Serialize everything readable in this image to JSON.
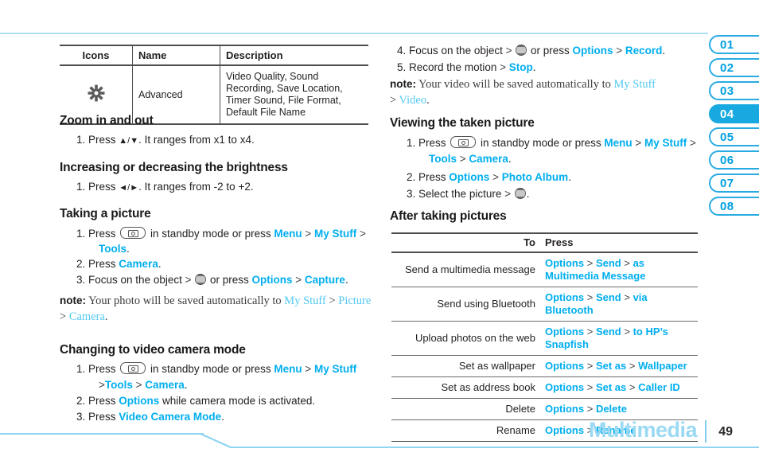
{
  "footer": {
    "section_title": "Multimedia",
    "page_number": "49"
  },
  "side_tabs": [
    {
      "label": "01",
      "active": false
    },
    {
      "label": "02",
      "active": false
    },
    {
      "label": "03",
      "active": false
    },
    {
      "label": "04",
      "active": true
    },
    {
      "label": "05",
      "active": false
    },
    {
      "label": "06",
      "active": false
    },
    {
      "label": "07",
      "active": false
    },
    {
      "label": "08",
      "active": false
    }
  ],
  "left_column": {
    "icon_table": {
      "headers": {
        "icons": "Icons",
        "name": "Name",
        "description": "Description"
      },
      "rows": [
        {
          "icon": "gear-icon",
          "name": "Advanced",
          "description": "Video Quality, Sound Recording, Save Location, Timer Sound, File Format, Default File Name"
        }
      ]
    },
    "sections": [
      {
        "heading": "Zoom in and out",
        "steps": [
          {
            "num": "1.",
            "text_a": "Press ",
            "arrows": "▲/▼",
            "text_b": ". It ranges from x1 to x4."
          }
        ]
      },
      {
        "heading": "Increasing or decreasing the brightness",
        "steps": [
          {
            "num": "1.",
            "text_a": "Press ",
            "arrows": "◄/►",
            "text_b": ". It ranges from -2 to +2."
          }
        ]
      },
      {
        "heading": "Taking a picture",
        "step1": {
          "num": "1.",
          "pre": "Press ",
          "key": "camera-key-icon",
          "mid": " in standby mode or press ",
          "menu": "Menu",
          "gt1": " > ",
          "mystuff": "My Stuff",
          "gt2": " > ",
          "tools": "Tools",
          "end": "."
        },
        "step2": {
          "num": "2.",
          "pre": "Press ",
          "camera": "Camera",
          "end": "."
        },
        "step3": {
          "num": "3.",
          "pre": "Focus on the object ",
          "gt1": "> ",
          "icon": "att-globe-icon",
          "mid": " or press ",
          "options": "Options",
          "gt2": " > ",
          "capture": "Capture",
          "end": "."
        },
        "note": {
          "label": "note:",
          "t1": " Your photo will be saved automatically to ",
          "l1": "My Stuff",
          "gt1": " > ",
          "l2": "Picture",
          "gt2": " > ",
          "l3": "Camera",
          "end": "."
        }
      },
      {
        "heading": "Changing to video camera mode",
        "step1": {
          "num": "1.",
          "pre": "Press ",
          "key": "camera-key-icon",
          "mid": " in standby mode or press ",
          "menu": "Menu",
          "gt1": " > ",
          "mystuff": "My Stuff",
          "gt2": ">",
          "tools": "Tools",
          "gt3": " > ",
          "camera": "Camera",
          "end": "."
        },
        "step2": {
          "num": "2.",
          "pre": "Press ",
          "options": "Options",
          "post": " while camera mode is activated."
        },
        "step3": {
          "num": "3.",
          "pre": "Press ",
          "mode": "Video Camera Mode",
          "end": "."
        }
      }
    ]
  },
  "right_column": {
    "continued_steps": {
      "step4": {
        "num": "4.",
        "pre": "Focus on the object ",
        "gt1": "> ",
        "icon": "att-globe-icon",
        "mid": " or press ",
        "options": "Options",
        "gt2": " > ",
        "record": "Record",
        "end": "."
      },
      "step5": {
        "num": "5.",
        "pre": "Record the motion ",
        "gt1": "> ",
        "stop": "Stop",
        "end": "."
      },
      "note": {
        "label": "note:",
        "t1": " Your video will be saved automatically to ",
        "l1": "My Stuff",
        "gt1": "> ",
        "l2": "Video",
        "end": "."
      }
    },
    "viewing_section": {
      "heading": "Viewing the taken picture",
      "step1": {
        "num": "1.",
        "pre": "Press ",
        "key": "camera-key-icon",
        "mid": " in standby mode or press ",
        "menu": "Menu",
        "gt1": " > ",
        "mystuff": "My Stuff",
        "gt2": " > ",
        "tools": "Tools",
        "gt3": " > ",
        "camera": "Camera",
        "end": "."
      },
      "step2": {
        "num": "2.",
        "pre": "Press ",
        "options": "Options",
        "gt1": " > ",
        "album": "Photo Album",
        "end": "."
      },
      "step3": {
        "num": "3.",
        "pre": "Select the picture ",
        "gt1": "> ",
        "icon": "att-globe-icon",
        "end": "."
      }
    },
    "after_section": {
      "heading": "After taking pictures",
      "table": {
        "headers": {
          "to": "To",
          "press": "Press"
        },
        "rows": [
          {
            "to": "Send a multimedia message",
            "press": [
              "Options",
              "Send",
              "as Multimedia Message"
            ]
          },
          {
            "to": "Send using Bluetooth",
            "press": [
              "Options",
              "Send",
              "via Bluetooth"
            ]
          },
          {
            "to": "Upload photos on the web",
            "press": [
              "Options",
              "Send",
              "to HP’s Snapfish"
            ]
          },
          {
            "to": "Set as wallpaper",
            "press": [
              "Options",
              "Set as",
              "Wallpaper"
            ]
          },
          {
            "to": "Set as address book",
            "press": [
              "Options",
              "Set as",
              "Caller ID"
            ]
          },
          {
            "to": "Delete",
            "press": [
              "Options",
              "Delete"
            ]
          },
          {
            "to": "Rename",
            "press": [
              "Options",
              "Rename"
            ]
          }
        ]
      }
    }
  },
  "colors": {
    "accent_blue": "#00aeef",
    "tab_blue": "#17a9e0",
    "rule_blue": "#8fd4f2",
    "footer_blue": "#9bd9f3"
  }
}
